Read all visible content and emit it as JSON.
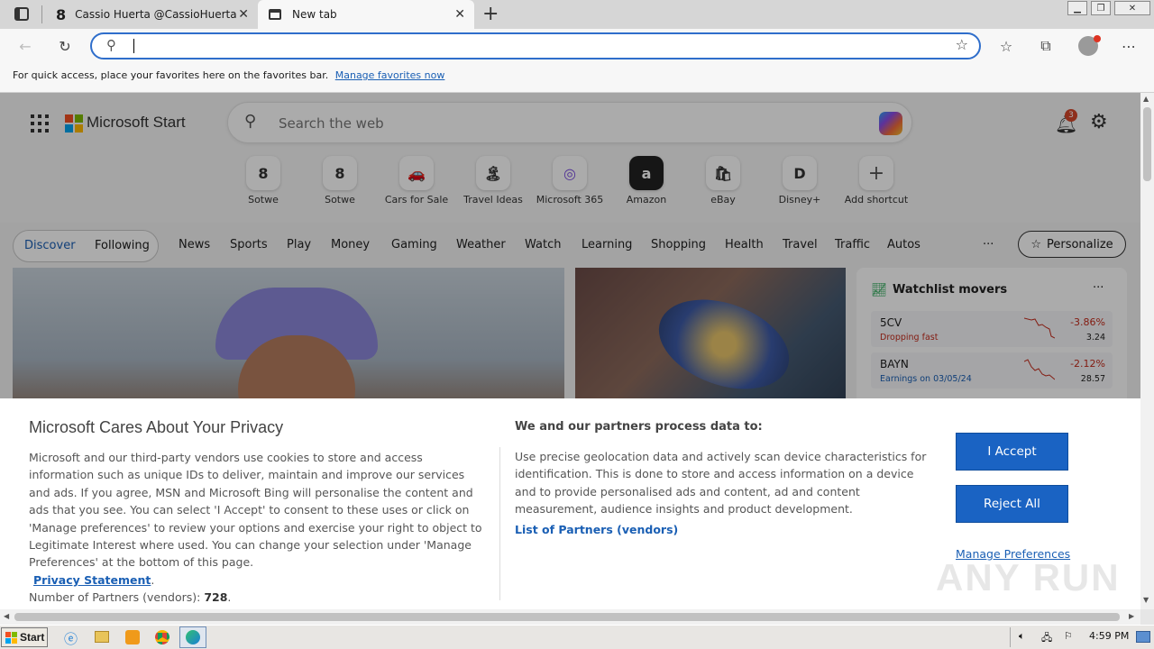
{
  "browser": {
    "tabs": [
      {
        "title": "Cassio Huerta @CassioHuerta - T",
        "icon": "threads-icon"
      },
      {
        "title": "New tab",
        "icon": "newtab-icon"
      }
    ],
    "new_tab_symbol": "+",
    "address": {
      "value": "",
      "placeholder": ""
    },
    "favorites_bar": {
      "message": "For quick access, place your favorites here on the favorites bar.",
      "link": "Manage favorites now"
    }
  },
  "msn": {
    "brand": "Microsoft Start",
    "search_placeholder": "Search the web",
    "notification_count": "3",
    "shortcuts": [
      {
        "label": "Sotwe",
        "glyph": "𝟴"
      },
      {
        "label": "Sotwe",
        "glyph": "𝟴"
      },
      {
        "label": "Cars for Sale",
        "glyph": "🚗"
      },
      {
        "label": "Travel Ideas",
        "glyph": "🏝"
      },
      {
        "label": "Microsoft 365",
        "glyph": "◎"
      },
      {
        "label": "Amazon",
        "glyph": "a"
      },
      {
        "label": "eBay",
        "glyph": "🛍"
      },
      {
        "label": "Disney+",
        "glyph": "D"
      },
      {
        "label": "Add shortcut",
        "glyph": "+"
      }
    ],
    "nav": {
      "discover": "Discover",
      "following": "Following",
      "items": [
        "News",
        "Sports",
        "Play",
        "Money",
        "Gaming",
        "Weather",
        "Watch",
        "Learning",
        "Shopping",
        "Health",
        "Travel",
        "Traffic",
        "Autos"
      ],
      "more": "···",
      "personalize": "Personalize"
    },
    "watchlist": {
      "title": "Watchlist movers",
      "more": "···",
      "rows": [
        {
          "symbol": "5CV",
          "sub": "Dropping fast",
          "change": "-3.86%",
          "price": "3.24"
        },
        {
          "symbol": "BAYN",
          "sub": "Earnings on 03/05/24",
          "change": "-2.12%",
          "price": "28.57"
        }
      ]
    }
  },
  "privacy": {
    "title": "Microsoft Cares About Your Privacy",
    "body": "Microsoft and our third-party vendors use cookies to store and access information such as unique IDs to deliver, maintain and improve our services and ads. If you agree, MSN and Microsoft Bing will personalise the content and ads that you see. You can select 'I Accept' to consent to these uses or click on 'Manage preferences' to review your options and exercise your right to object to Legitimate Interest where used.  You can change your selection under 'Manage Preferences' at the bottom of this page.",
    "privacy_link": "Privacy Statement",
    "partners_label": "Number of Partners (vendors):",
    "partners_count": "728",
    "right_title": "We and our partners process data to:",
    "right_body": "Use precise geolocation data and actively scan device characteristics for identification. This is done to store and access information on a device and to provide personalised ads and content, ad and content measurement, audience insights and product development.",
    "partners_link": "List of Partners (vendors)",
    "accept": "I Accept",
    "reject": "Reject All",
    "manage": "Manage Preferences"
  },
  "taskbar": {
    "start": "Start",
    "time": "4:59 PM"
  },
  "watermark": "ANY RUN"
}
